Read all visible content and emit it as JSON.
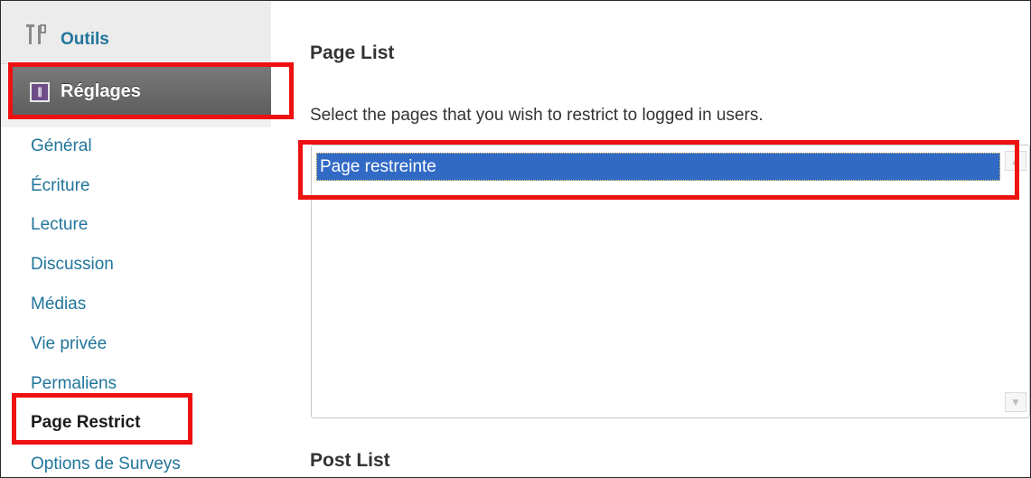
{
  "sidebar": {
    "outils": {
      "label": "Outils",
      "icon": "tools-icon"
    },
    "reglages": {
      "label": "Réglages",
      "icon": "settings-icon"
    },
    "submenu": [
      {
        "label": "Général"
      },
      {
        "label": "Écriture"
      },
      {
        "label": "Lecture"
      },
      {
        "label": "Discussion"
      },
      {
        "label": "Médias"
      },
      {
        "label": "Vie privée"
      },
      {
        "label": "Permaliens"
      },
      {
        "label": "Page Restrict",
        "active": true
      },
      {
        "label": "Options de Surveys"
      }
    ]
  },
  "main": {
    "page_list_title": "Page List",
    "page_list_description": "Select the pages that you wish to restrict to logged in users.",
    "page_options": [
      {
        "label": "Page restreinte",
        "selected": true
      }
    ],
    "post_list_title": "Post List"
  },
  "colors": {
    "link": "#21759b",
    "selection": "#316ac5",
    "highlight": "#ee1111",
    "menu_active_bg": "#6a6a6a"
  }
}
